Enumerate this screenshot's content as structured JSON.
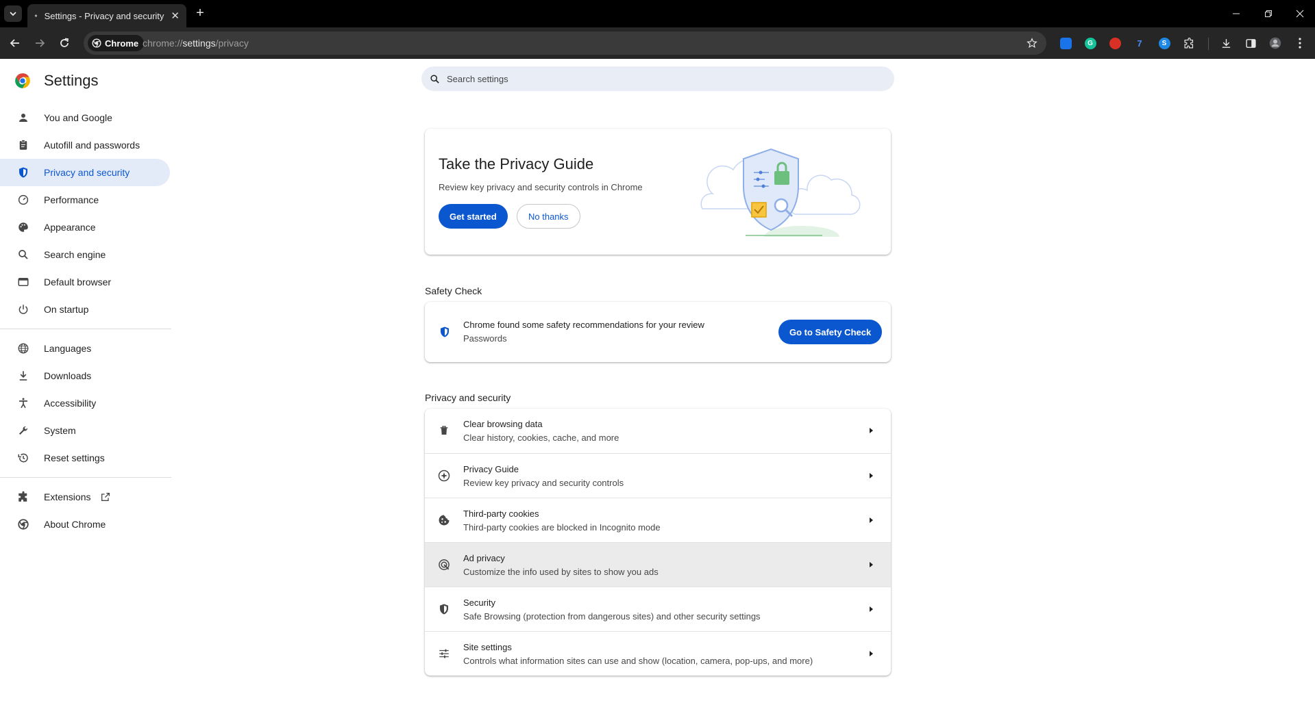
{
  "browser": {
    "tab_title": "Settings - Privacy and security",
    "chip_label": "Chrome",
    "url_scheme": "chrome://",
    "url_host": "settings",
    "url_path": "/privacy"
  },
  "sidebar": {
    "title": "Settings",
    "groups": [
      [
        {
          "label": "You and Google",
          "icon": "person-icon"
        },
        {
          "label": "Autofill and passwords",
          "icon": "clipboard-icon"
        },
        {
          "label": "Privacy and security",
          "icon": "shield-icon",
          "active": true
        },
        {
          "label": "Performance",
          "icon": "speedometer-icon"
        },
        {
          "label": "Appearance",
          "icon": "palette-icon"
        },
        {
          "label": "Search engine",
          "icon": "search-icon"
        },
        {
          "label": "Default browser",
          "icon": "browser-window-icon"
        },
        {
          "label": "On startup",
          "icon": "power-icon"
        }
      ],
      [
        {
          "label": "Languages",
          "icon": "globe-icon"
        },
        {
          "label": "Downloads",
          "icon": "download-icon"
        },
        {
          "label": "Accessibility",
          "icon": "accessibility-icon"
        },
        {
          "label": "System",
          "icon": "wrench-icon"
        },
        {
          "label": "Reset settings",
          "icon": "history-icon"
        }
      ],
      [
        {
          "label": "Extensions",
          "icon": "puzzle-icon"
        },
        {
          "label": "About Chrome",
          "icon": "chrome-logo-icon"
        }
      ]
    ]
  },
  "search": {
    "placeholder": "Search settings"
  },
  "privacy_guide": {
    "title": "Take the Privacy Guide",
    "subtitle": "Review key privacy and security controls in Chrome",
    "primary_label": "Get started",
    "secondary_label": "No thanks"
  },
  "safety_check": {
    "section_title": "Safety Check",
    "title": "Chrome found some safety recommendations for your review",
    "subtitle": "Passwords",
    "button_label": "Go to Safety Check"
  },
  "privacy_section": {
    "section_title": "Privacy and security",
    "rows": [
      {
        "title": "Clear browsing data",
        "subtitle": "Clear history, cookies, cache, and more",
        "icon": "trash-icon"
      },
      {
        "title": "Privacy Guide",
        "subtitle": "Review key privacy and security controls",
        "icon": "compass-icon"
      },
      {
        "title": "Third-party cookies",
        "subtitle": "Third-party cookies are blocked in Incognito mode",
        "icon": "cookie-icon"
      },
      {
        "title": "Ad privacy",
        "subtitle": "Customize the info used by sites to show you ads",
        "icon": "ad-privacy-icon",
        "hover": true
      },
      {
        "title": "Security",
        "subtitle": "Safe Browsing (protection from dangerous sites) and other security settings",
        "icon": "security-shield-icon"
      },
      {
        "title": "Site settings",
        "subtitle": "Controls what information sites can use and show (location, camera, pop-ups, and more)",
        "icon": "sliders-icon"
      }
    ]
  },
  "colors": {
    "accent": "#0b57d0",
    "active_bg": "#e3ebf8",
    "toolbar": "#262626",
    "tabstrip": "#000000"
  }
}
